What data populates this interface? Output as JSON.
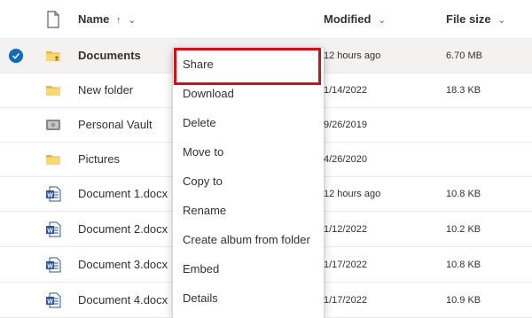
{
  "header": {
    "name_label": "Name",
    "sort_glyph": "↑",
    "chevron_glyph": "⌄",
    "modified_label": "Modified",
    "size_label": "File size"
  },
  "files": [
    {
      "name": "Documents",
      "modified": "12 hours ago",
      "size": "6.70 MB",
      "icon": "shared-folder-icon",
      "selected": true
    },
    {
      "name": "New folder",
      "modified": "1/14/2022",
      "size": "18.3 KB",
      "icon": "folder-icon",
      "selected": false
    },
    {
      "name": "Personal Vault",
      "modified": "9/26/2019",
      "size": "",
      "icon": "vault-icon",
      "selected": false
    },
    {
      "name": "Pictures",
      "modified": "4/26/2020",
      "size": "",
      "icon": "folder-icon",
      "selected": false
    },
    {
      "name": "Document 1.docx",
      "modified": "12 hours ago",
      "size": "10.8 KB",
      "icon": "word-doc-icon",
      "selected": false
    },
    {
      "name": "Document 2.docx",
      "modified": "1/12/2022",
      "size": "10.2 KB",
      "icon": "word-doc-icon",
      "selected": false
    },
    {
      "name": "Document 3.docx",
      "modified": "1/17/2022",
      "size": "10.8 KB",
      "icon": "word-doc-icon",
      "selected": false
    },
    {
      "name": "Document 4.docx",
      "modified": "1/17/2022",
      "size": "10.9 KB",
      "icon": "word-doc-icon",
      "selected": false
    }
  ],
  "context_menu": {
    "items": [
      "Share",
      "Download",
      "Delete",
      "Move to",
      "Copy to",
      "Rename",
      "Create album from folder",
      "Embed",
      "Details"
    ],
    "highlighted": "Share"
  },
  "colors": {
    "accent": "#0f6cbd",
    "highlight_border": "#d0111b",
    "folder": "#f8d775",
    "word": "#2b579a",
    "selected_row": "#f3f2f1"
  }
}
